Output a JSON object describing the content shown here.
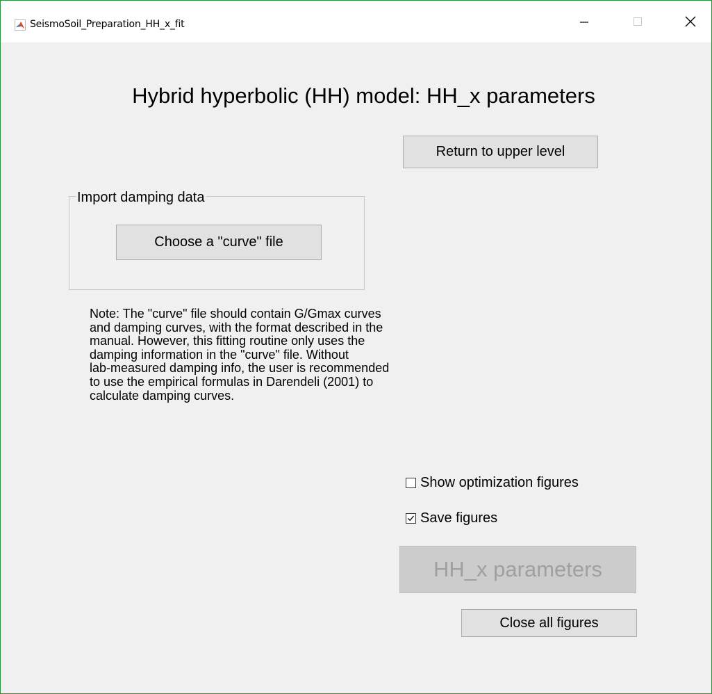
{
  "window": {
    "title": "SeismoSoil_Preparation_HH_x_fit",
    "controls": {
      "minimize_icon": "minimize-icon",
      "maximize_icon": "maximize-icon",
      "close_icon": "close-icon"
    },
    "app_icon": "matlab-icon"
  },
  "main": {
    "heading": "Hybrid hyperbolic (HH) model: HH_x parameters",
    "return_button": "Return to upper level",
    "import_group": {
      "legend": "Import damping data",
      "choose_button": "Choose a \"curve\" file"
    },
    "note": "Note: The \"curve\" file should contain G/Gmax curves\nand damping curves, with the format described in the\nmanual. However, this fitting routine only uses the\ndamping information in the \"curve\" file. Without\nlab-measured damping info, the user is recommended\nto use the empirical formulas in Darendeli (2001) to\ncalculate damping curves.",
    "options": {
      "show_optimization": {
        "label": "Show optimization figures",
        "checked": false
      },
      "save_figures": {
        "label": "Save figures",
        "checked": true
      }
    },
    "hhx_button": {
      "label": "HH_x parameters",
      "enabled": false
    },
    "close_all_button": "Close all figures"
  },
  "colors": {
    "background": "#f0f0f0",
    "button_face": "#e1e1e1",
    "disabled_text": "#a0a0a0",
    "window_border": "#2f8f3f"
  }
}
